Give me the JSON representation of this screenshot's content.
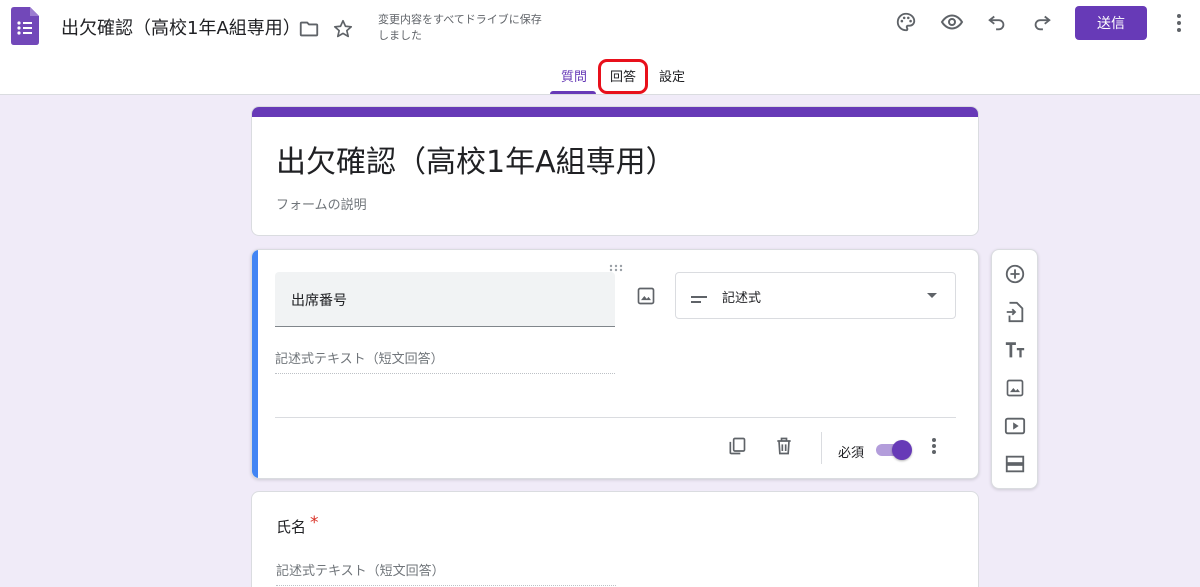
{
  "header": {
    "title": "出欠確認（高校1年A組専用）",
    "save_status": "変更内容をすべてドライブに保存しました",
    "send_label": "送信",
    "icons": [
      "forms-logo-icon",
      "folder-icon",
      "star-icon",
      "palette-icon",
      "preview-eye-icon",
      "undo-icon",
      "redo-icon",
      "more-vert-icon"
    ]
  },
  "tabs": [
    {
      "label": "質問",
      "active": true
    },
    {
      "label": "回答",
      "active": false,
      "highlighted": true
    },
    {
      "label": "設定",
      "active": false
    }
  ],
  "form": {
    "title": "出欠確認（高校1年A組専用）",
    "description_placeholder": "フォームの説明"
  },
  "questions": [
    {
      "title": "出席番号",
      "type": "記述式",
      "answer_hint": "記述式テキスト（短文回答）",
      "required_label": "必須",
      "required_on": true
    },
    {
      "title": "氏名",
      "required_mark": "*",
      "answer_hint": "記述式テキスト（短文回答）"
    }
  ],
  "side_toolbar": [
    "add-question-icon",
    "import-questions-icon",
    "add-title-icon",
    "add-image-icon",
    "add-video-icon",
    "add-section-icon"
  ],
  "colors": {
    "accent": "#673ab7",
    "active_question": "#4285f4",
    "highlight_box": "#e8101b",
    "background": "#f0ebf8"
  }
}
